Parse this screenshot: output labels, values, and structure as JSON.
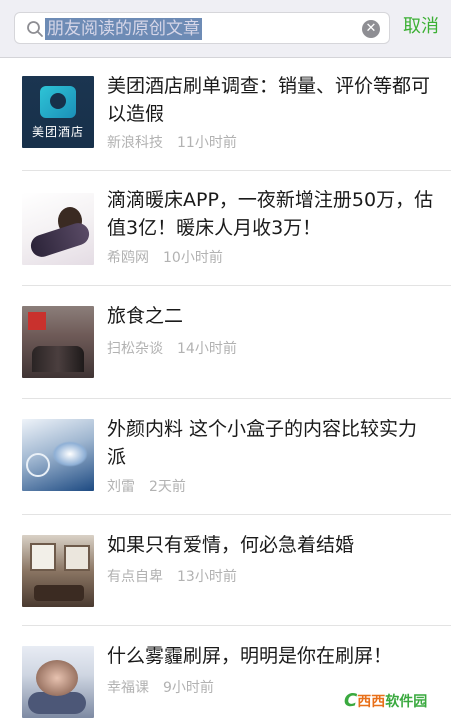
{
  "search": {
    "query": "朋友阅读的原创文章",
    "cancel_label": "取消"
  },
  "articles": [
    {
      "title": "美团酒店刷单调查：销量、评价等都可以造假",
      "source": "新浪科技",
      "time": "11小时前",
      "thumb_text": "美团酒店"
    },
    {
      "title": "滴滴暖床APP，一夜新增注册50万，估值3亿！暖床人月收3万！",
      "source": "希鸥网",
      "time": "10小时前"
    },
    {
      "title": "旅食之二",
      "source": "扫松杂谈",
      "time": "14小时前"
    },
    {
      "title": "外颜内料 这个小盒子的内容比较实力派",
      "source": "刘雷",
      "time": "2天前"
    },
    {
      "title": "如果只有爱情，何必急着结婚",
      "source": "有点自卑",
      "time": "13小时前"
    },
    {
      "title": "什么雾霾刷屏，明明是你在刷屏！",
      "source": "幸福课",
      "time": "9小时前"
    }
  ],
  "watermark": {
    "c": "C",
    "brand": "西西",
    "suffix": "软件园"
  }
}
